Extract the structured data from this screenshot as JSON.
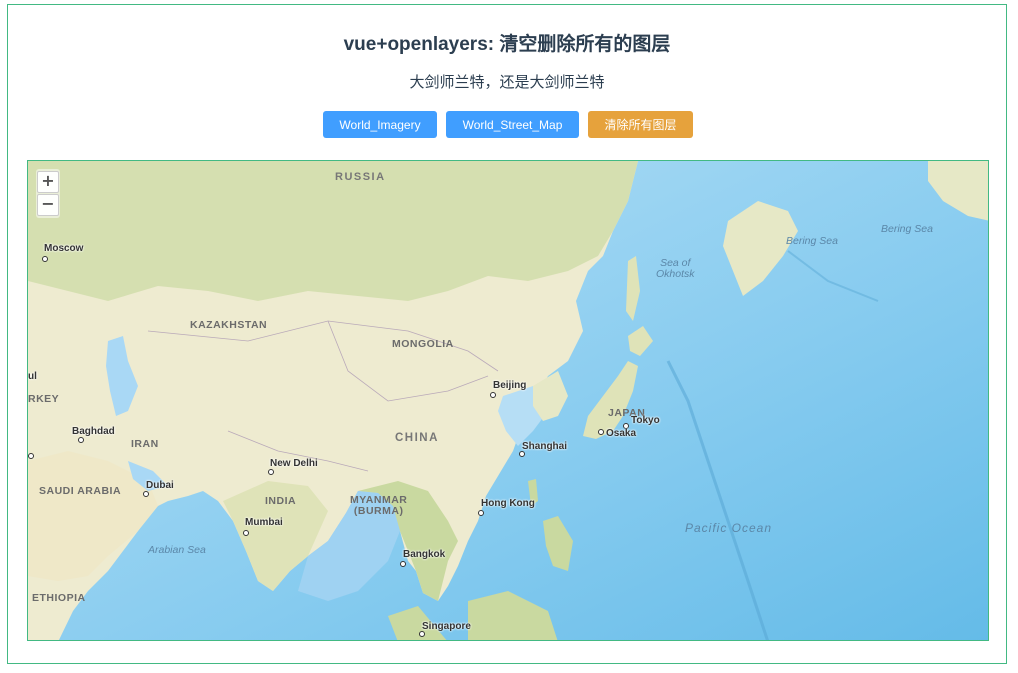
{
  "header": {
    "title": "vue+openlayers: 清空删除所有的图层",
    "subtitle": "大剑师兰特，还是大剑师兰特"
  },
  "toolbar": {
    "buttons": [
      {
        "label": "World_Imagery",
        "color": "#409eff"
      },
      {
        "label": "World_Street_Map",
        "color": "#409eff"
      },
      {
        "label": "清除所有图层",
        "color": "#e6a23c"
      }
    ]
  },
  "map": {
    "zoom_in": "+",
    "zoom_out": "−",
    "countries": {
      "russia": "RUSSIA",
      "kazakhstan": "KAZAKHSTAN",
      "mongolia": "MONGOLIA",
      "china": "CHINA",
      "iran": "IRAN",
      "saudi_arabia": "SAUDI ARABIA",
      "india": "INDIA",
      "myanmar": "MYANMAR\n(BURMA)",
      "japan": "JAPAN",
      "ethiopia": "ETHIOPIA",
      "turkey": "RKEY"
    },
    "cities": {
      "moscow": "Moscow",
      "istanbul": "ul",
      "baghdad": "Baghdad",
      "dubai": "Dubai",
      "new_delhi": "New Delhi",
      "mumbai": "Mumbai",
      "beijing": "Beijing",
      "shanghai": "Shanghai",
      "hong_kong": "Hong Kong",
      "bangkok": "Bangkok",
      "singapore": "Singapore",
      "tokyo": "Tokyo",
      "osaka": "Osaka"
    },
    "seas": {
      "okhotsk": "Sea of\nOkhotsk",
      "bering1": "Bering Sea",
      "bering2": "Bering Sea",
      "arabian": "Arabian Sea",
      "pacific": "Pacific Ocean"
    },
    "colors": {
      "land": "#eeebd0",
      "land_green": "#c9d9a0",
      "ocean": "#a9d8f5",
      "deep_ocean": "#6cc0ea",
      "frame_border": "#42b983"
    }
  }
}
